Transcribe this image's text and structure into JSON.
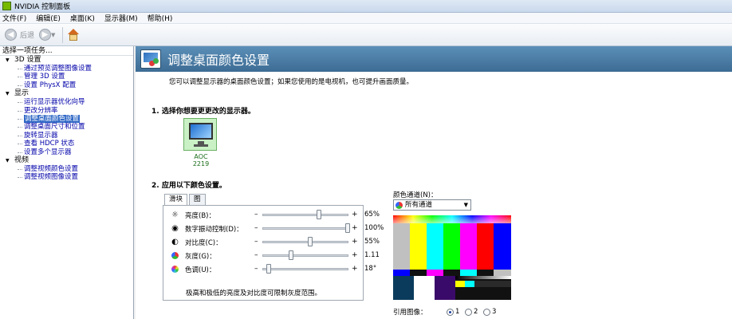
{
  "window": {
    "title": "NVIDIA 控制面板"
  },
  "menu": [
    "文件(F)",
    "编辑(E)",
    "桌面(K)",
    "显示器(M)",
    "帮助(H)"
  ],
  "toolbar": {
    "back_label": "后退"
  },
  "sidebar": {
    "header": "选择一项任务...",
    "groups": [
      {
        "label": "3D 设置",
        "items": [
          "通过预览调整图像设置",
          "管理 3D 设置",
          "设置 PhysX 配置"
        ]
      },
      {
        "label": "显示",
        "items": [
          "运行显示器优化向导",
          "更改分辨率",
          "调整桌面颜色设置",
          "调整桌面尺寸和位置",
          "旋转显示器",
          "查看 HDCP 状态",
          "设置多个显示器"
        ]
      },
      {
        "label": "视频",
        "items": [
          "调整视频颜色设置",
          "调整视频图像设置"
        ]
      }
    ]
  },
  "main": {
    "title": "调整桌面颜色设置",
    "description": "您可以调整显示器的桌面颜色设置；如果您使用的是电视机，也可提升画面质量。",
    "section1": "1. 选择你想要更更改的显示器。",
    "monitor": {
      "label": "AOC 2219"
    },
    "section2": "2. 应用以下颜色设置。",
    "tabs": [
      "滑块",
      "图"
    ],
    "sliders": [
      {
        "label": "亮度(B)：",
        "value": "65%",
        "level": 0.65
      },
      {
        "label": "数字振动控制(D)：",
        "value": "100%",
        "level": 1.0
      },
      {
        "label": "对比度(C)：",
        "value": "55%",
        "level": 0.55
      },
      {
        "label": "灰度(G)：",
        "value": "1.11",
        "level": 0.32
      },
      {
        "label": "色调(U)：",
        "value": "18°",
        "level": 0.05
      }
    ],
    "slider_note": "极高和极低的亮度及对比度可限制灰度范围。",
    "color_channel": {
      "label": "颜色通道(N)：",
      "selected": "所有通道"
    },
    "reference": {
      "label": "引用图像：",
      "options": [
        "1",
        "2",
        "3"
      ],
      "selected": "1"
    }
  },
  "icons": {
    "brightness": "sun-icon",
    "vibrance": "vibrance-icon",
    "contrast": "contrast-icon",
    "gamma": "gamma-icon",
    "hue": "hue-icon"
  }
}
